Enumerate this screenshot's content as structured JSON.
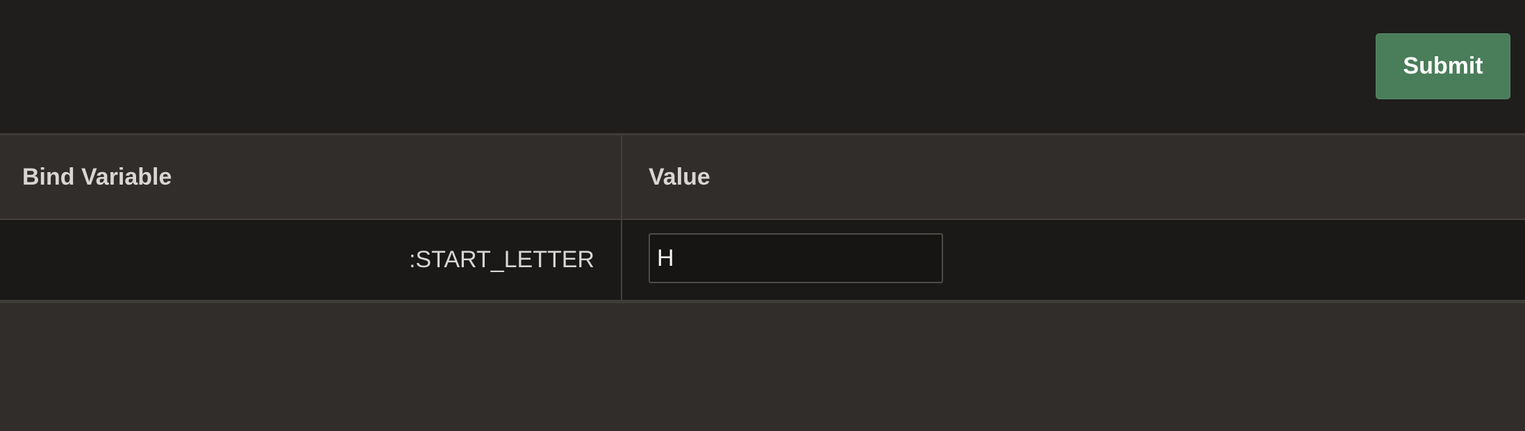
{
  "toolbar": {
    "submit_label": "Submit"
  },
  "table": {
    "headers": [
      "Bind Variable",
      "Value"
    ],
    "rows": [
      {
        "bind_variable": ":START_LETTER",
        "value": "H"
      }
    ]
  }
}
